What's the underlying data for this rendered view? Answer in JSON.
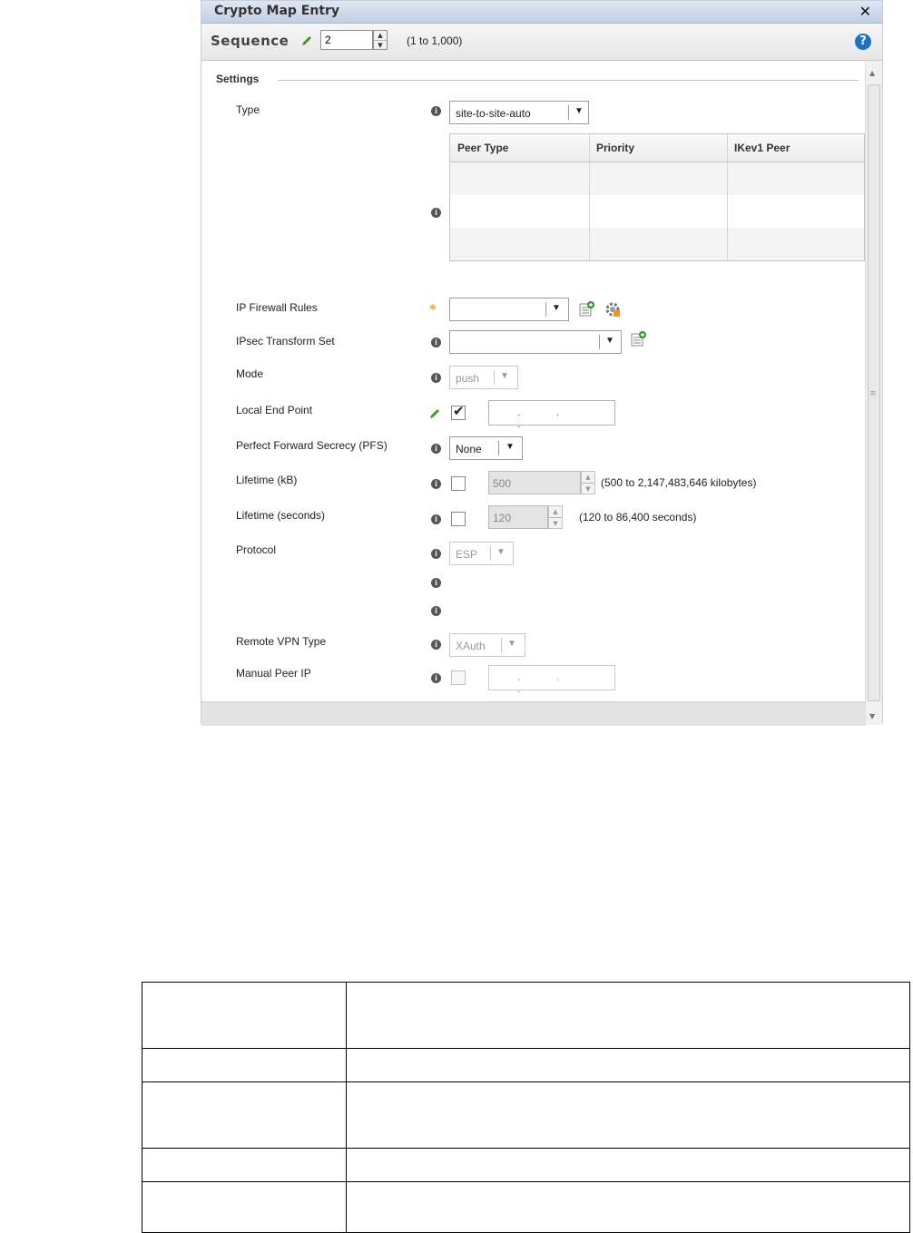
{
  "dialog": {
    "title": "Crypto Map Entry",
    "close_icon": "close-icon",
    "help_icon": "help-icon",
    "help_glyph": "?",
    "close_glyph": "✕"
  },
  "sequence": {
    "label": "Sequence",
    "value": "2",
    "range": "(1 to 1,000)"
  },
  "settings": {
    "section_title": "Settings",
    "type": {
      "label": "Type",
      "value": "site-to-site-auto"
    },
    "peer_table": {
      "columns": [
        "Peer Type",
        "Priority",
        "IKev1 Peer"
      ],
      "rows": []
    },
    "ip_firewall_rules": {
      "label": "IP Firewall Rules",
      "value": ""
    },
    "ipsec_transform_set": {
      "label": "IPsec Transform Set",
      "value": ""
    },
    "mode": {
      "label": "Mode",
      "value": "push"
    },
    "local_end_point": {
      "label": "Local End Point",
      "checked": true,
      "ip": ".     .     ."
    },
    "pfs": {
      "label": "Perfect Forward Secrecy (PFS)",
      "value": "None"
    },
    "lifetime_kb": {
      "label": "Lifetime (kB)",
      "value": "500",
      "range": "(500 to 2,147,483,646 kilobytes)",
      "checked": false
    },
    "lifetime_seconds": {
      "label": "Lifetime (seconds)",
      "value": "120",
      "range": "(120 to 86,400 seconds)",
      "checked": false
    },
    "protocol": {
      "label": "Protocol",
      "value": "ESP"
    },
    "remote_vpn_type": {
      "label": "Remote VPN Type",
      "value": "XAuth"
    },
    "manual_peer_ip": {
      "label": "Manual Peer IP",
      "checked": false,
      "ip": ".     .     ."
    }
  },
  "glyphs": {
    "info": "i",
    "required": "*",
    "check": "✔",
    "arrow_down": "▼",
    "spin_up": "▲",
    "spin_down": "▼"
  },
  "colors": {
    "title_bar": "#c3cfe4",
    "help": "#1a73c8",
    "required": "#f5a623",
    "edit_pencil": "#3c9a1e"
  },
  "doc_table": {
    "rows": 5
  }
}
